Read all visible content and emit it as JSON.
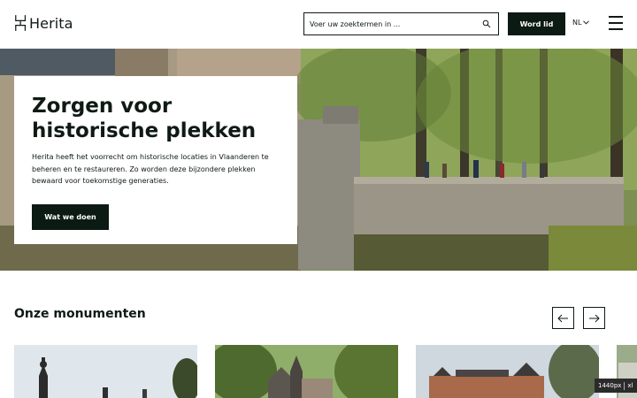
{
  "header": {
    "logo_text": "Herita",
    "search_placeholder": "Voer uw zoektermen in ...",
    "join_label": "Word lid",
    "language": "NL"
  },
  "hero": {
    "title_line1": "Zorgen voor",
    "title_line2": "historische plekken",
    "text": "Herita heeft het voorrecht om historische locaties in Vlaanderen te beheren en te restaureren. Zo worden deze bijzondere plekken bewaard voor toekomstige generaties.",
    "button_label": "Wat we doen"
  },
  "monuments": {
    "title": "Onze monumenten"
  },
  "breakpoint_badge": {
    "size": "1440px",
    "name": "xl"
  }
}
